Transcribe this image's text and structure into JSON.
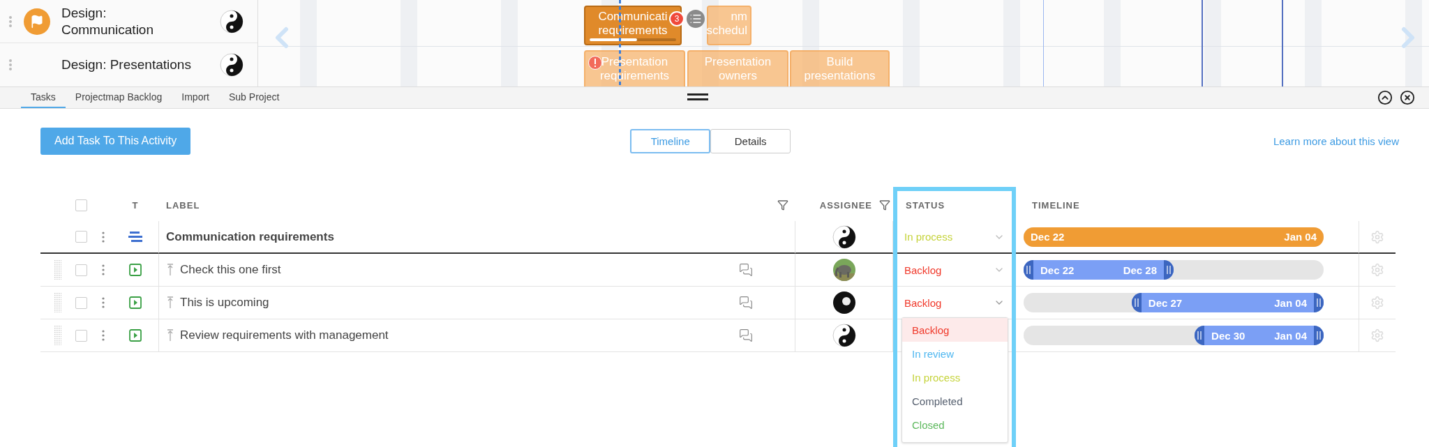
{
  "activities": [
    {
      "label": "Design:\nCommunication",
      "flagged": true
    },
    {
      "label": "Design: Presentations",
      "flagged": false
    }
  ],
  "gantt_cards": [
    {
      "lines": [
        "Communicati",
        "requirements"
      ],
      "selected": true,
      "badge": "3",
      "level": 0.55
    },
    {
      "lines": [
        "nm",
        "schedul"
      ],
      "selected": false
    },
    {
      "lines": [
        "Presentation",
        "requirements"
      ],
      "selected": false,
      "warning": true
    },
    {
      "lines": [
        "Presentation",
        "owners"
      ],
      "selected": false
    },
    {
      "lines": [
        "Build",
        "presentations"
      ],
      "selected": false
    }
  ],
  "panel_tabs": [
    {
      "label": "Tasks",
      "selected": true
    },
    {
      "label": "Projectmap Backlog",
      "selected": false
    },
    {
      "label": "Import",
      "selected": false
    },
    {
      "label": "Sub Project",
      "selected": false
    }
  ],
  "add_button": "Add Task To This Activity",
  "view_toggle": [
    {
      "label": "Timeline",
      "selected": true
    },
    {
      "label": "Details",
      "selected": false
    }
  ],
  "learn_more_link": "Learn more about this view",
  "table": {
    "select_all": {
      "checked": false
    },
    "columns": [
      "T",
      "LABEL",
      "ASSIGNEE",
      "STATUS",
      "TIMELINE"
    ],
    "rows": [
      {
        "kind": "summary",
        "label": "Communication requirements",
        "checked": false,
        "avatar": {
          "kind": "yinyang"
        },
        "status": {
          "text": "In process",
          "color": "#c5d33a",
          "open": false
        },
        "timeline": {
          "start": "Dec 22",
          "end": "Jan 04"
        }
      },
      {
        "kind": "task",
        "label": "Check this one first",
        "checked": false,
        "status": {
          "text": "Backlog",
          "color": "#f0392b",
          "open": false
        },
        "timeline": {
          "start": "Dec 22",
          "end": "Dec 28"
        }
      },
      {
        "kind": "task",
        "label": "This is upcoming",
        "checked": false,
        "avatar": {
          "kind": "ball"
        },
        "status": {
          "text": "Backlog",
          "color": "#f0392b",
          "open": true,
          "options": [
            {
              "label": "Backlog",
              "color": "#f0392b",
              "selected": true
            },
            {
              "label": "In review",
              "color": "#4fb7f0",
              "selected": false
            },
            {
              "label": "In process",
              "color": "#c5d33a",
              "selected": false
            },
            {
              "label": "Completed",
              "color": "#555f6e",
              "selected": false
            },
            {
              "label": "Closed",
              "color": "#5cb85c",
              "selected": false
            }
          ]
        },
        "timeline": {
          "start": "Dec 27",
          "end": "Jan 04"
        }
      },
      {
        "kind": "task",
        "label": "Review requirements with management",
        "checked": false,
        "avatar": {
          "kind": "yinyang"
        },
        "timeline": {
          "start": "Dec 30",
          "end": "Jan 04"
        }
      }
    ]
  }
}
